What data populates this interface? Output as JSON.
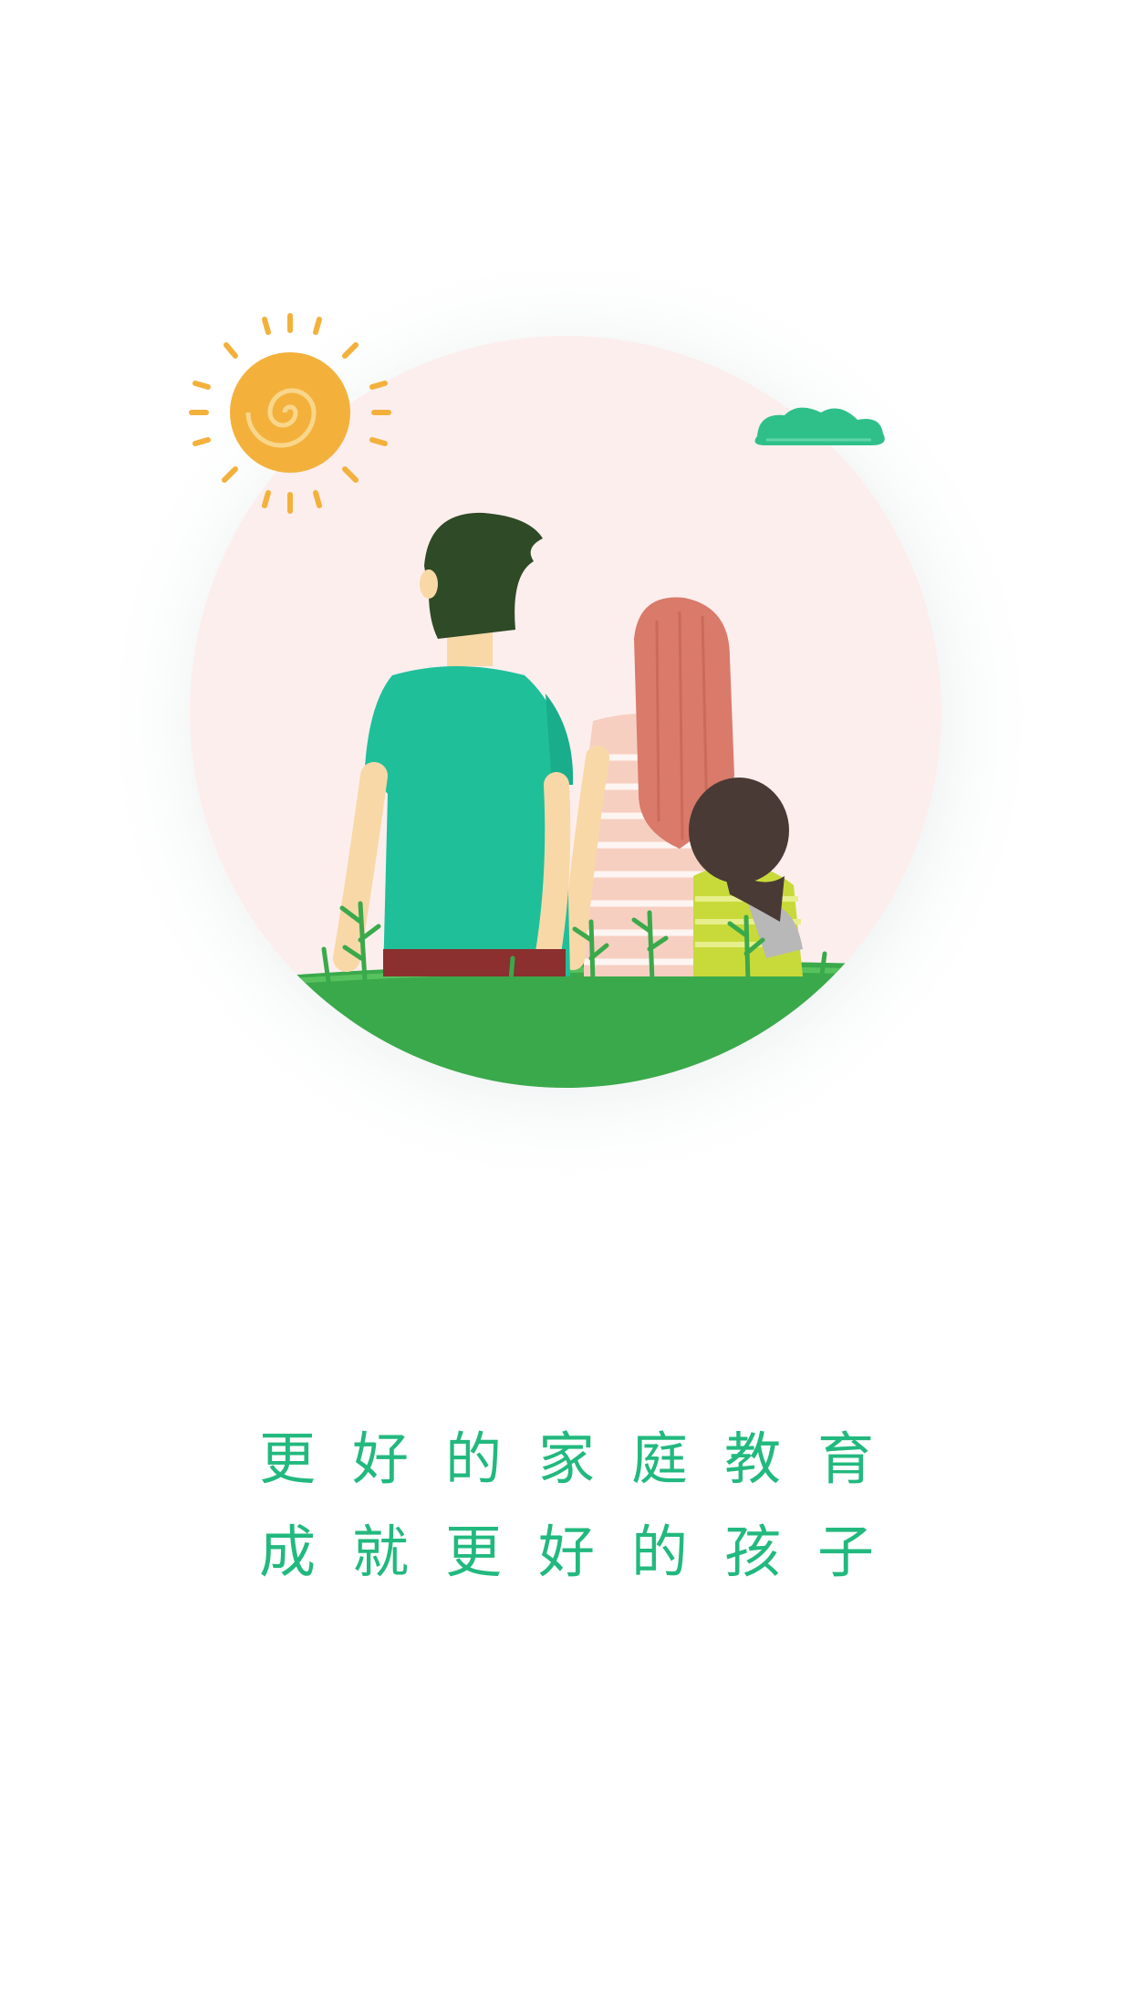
{
  "colors": {
    "accent": "#22b97e",
    "background": "#ffffff",
    "circle_bg": "#fdeeee",
    "grass": "#3aa94b",
    "man_shirt": "#1fbf9a",
    "woman_hair": "#d97a6a",
    "sun": "#f3b13c",
    "cloud": "#2fc08a"
  },
  "illustration": {
    "icon": "family-illustration"
  },
  "slogan": {
    "line1": "更好的家庭教育",
    "line2": "成就更好的孩子"
  }
}
